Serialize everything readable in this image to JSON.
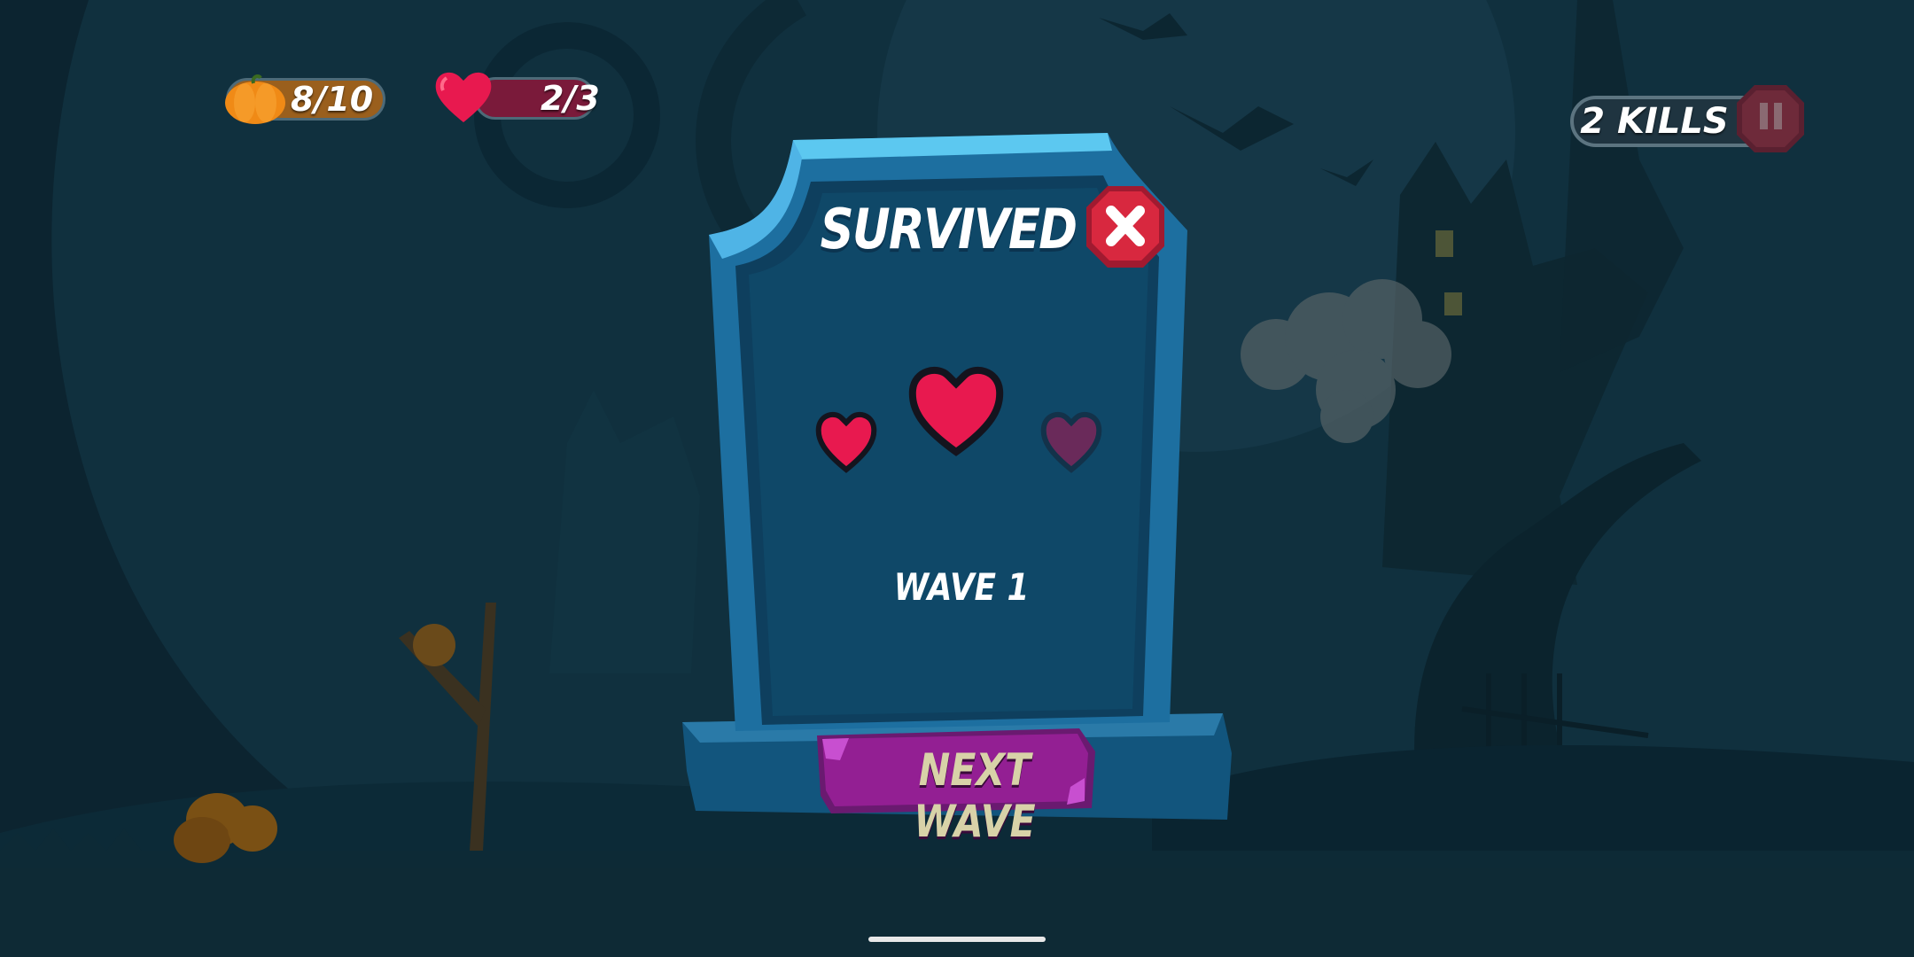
{
  "hud": {
    "pumpkins": "8/10",
    "lives": "2/3",
    "kills": "2 KILLS"
  },
  "panel": {
    "title": "SURVIVED",
    "hearts_earned": 2,
    "hearts_total": 3,
    "wave_label": "WAVE 1",
    "next_button": "NEXT WAVE"
  },
  "colors": {
    "background": "#0f2a36",
    "panel": "#0e4a6a",
    "heart": "#e8194f",
    "heart_empty": "#6a2a5a",
    "next_button": "#8c1f8f",
    "close_button": "#c8243c"
  },
  "icons": [
    "pumpkin-icon",
    "heart-icon",
    "pause-icon",
    "close-icon"
  ]
}
